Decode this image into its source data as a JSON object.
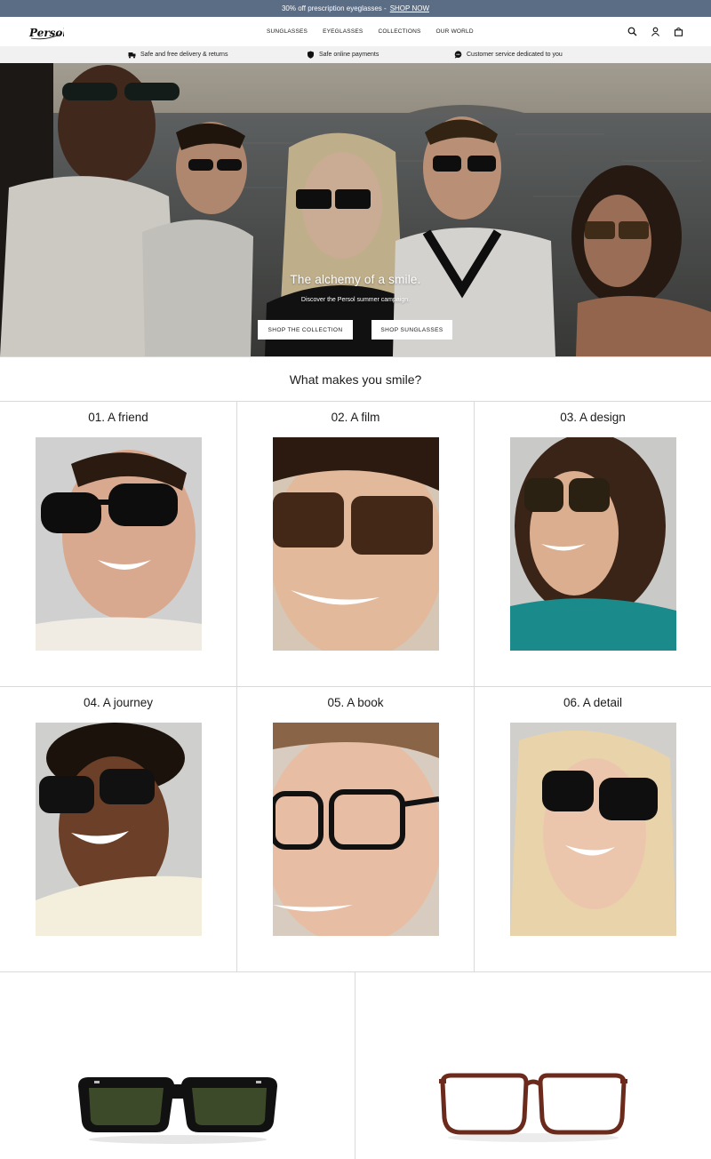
{
  "promo": {
    "text": "30% off prescription eyeglasses -",
    "link": "SHOP NOW",
    "bg_color": "#5b6c85"
  },
  "header": {
    "logo": "Persol",
    "nav": [
      "SUNGLASSES",
      "EYEGLASSES",
      "COLLECTIONS",
      "OUR WORLD"
    ],
    "icons": [
      "search-icon",
      "account-icon",
      "bag-icon"
    ]
  },
  "infobar": {
    "items": [
      {
        "icon": "delivery-icon",
        "text": "Safe and free delivery & returns"
      },
      {
        "icon": "shield-icon",
        "text": "Safe online payments"
      },
      {
        "icon": "chat-icon",
        "text": "Customer service dedicated to you"
      }
    ]
  },
  "hero": {
    "title": "The alchemy of a smile.",
    "subtitle": "Discover the Persol summer campaign.",
    "buttons": [
      "SHOP THE COLLECTION",
      "SHOP SUNGLASSES"
    ]
  },
  "section": {
    "title": "What makes you smile?",
    "cards": [
      {
        "title": "01. A friend"
      },
      {
        "title": "02. A film"
      },
      {
        "title": "03. A design"
      },
      {
        "title": "04. A journey"
      },
      {
        "title": "05. A book"
      },
      {
        "title": "06. A detail"
      }
    ]
  },
  "products": [
    {
      "icon": "sunglasses-product-icon",
      "frame_color": "#111111",
      "lens_color": "#3d4a2a"
    },
    {
      "icon": "eyeglasses-product-icon",
      "frame_color": "#6b2a1c",
      "lens_color": "#f4f4f4"
    }
  ],
  "colors": {
    "border": "#d9d9d9",
    "infobar_bg": "#f1f1f1"
  }
}
